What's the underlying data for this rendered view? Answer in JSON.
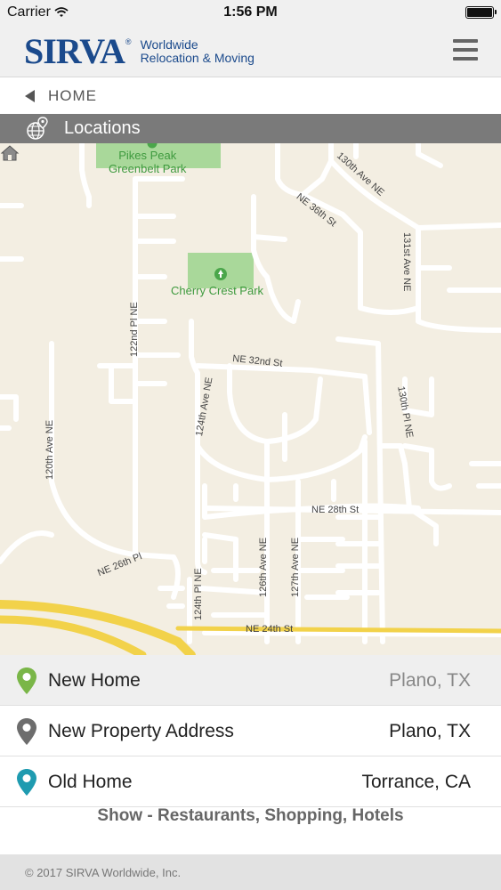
{
  "status": {
    "carrier": "Carrier",
    "time": "1:56 PM"
  },
  "header": {
    "logo_text": "SIRVA",
    "logo_reg": "®",
    "tagline_line1": "Worldwide",
    "tagline_line2": "Relocation & Moving"
  },
  "nav": {
    "home_label": "HOME"
  },
  "section": {
    "title": "Locations",
    "icon": "globe-pin-icon"
  },
  "map": {
    "streets": [
      "NE 36th St",
      "130th Ave NE",
      "131st Ave NE",
      "122nd Pl NE",
      "NE 32nd St",
      "124th Ave NE",
      "130th Pl NE",
      "120th Ave NE",
      "NE 28th St",
      "NE 26th Pl",
      "124th Pl NE",
      "126th Ave NE",
      "127th Ave NE",
      "NE 24th St"
    ],
    "parks": [
      "Pikes Peak\nGreenbelt Park",
      "Cherry Crest Park"
    ],
    "marker": "house-icon"
  },
  "locations": [
    {
      "name": "New Home",
      "city": "Plano, TX",
      "pin_color": "#7ab648",
      "active": true
    },
    {
      "name": "New Property Address",
      "city": "Plano, TX",
      "pin_color": "#6d6d6d",
      "active": false
    },
    {
      "name": "Old Home",
      "city": "Torrance, CA",
      "pin_color": "#1f9bb0",
      "active": false
    }
  ],
  "show_link": "Show - Restaurants, Shopping, Hotels",
  "footer": {
    "copyright": "© 2017 SIRVA Worldwide, Inc."
  },
  "colors": {
    "brand_blue": "#1b4a8c",
    "section_bar": "#7a7a7a",
    "map_bg": "#f3eee2",
    "highway": "#f2d24a"
  }
}
